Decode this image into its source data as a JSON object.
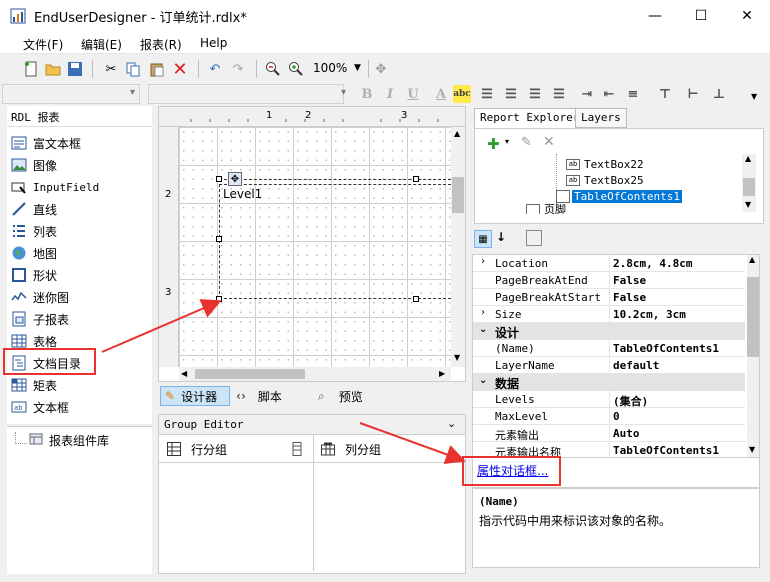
{
  "window": {
    "title": "EndUserDesigner - 订单统计.rdlx*",
    "minimize": "—",
    "maximize": "☐",
    "close": "✕"
  },
  "menu": [
    {
      "label": "文件(F)"
    },
    {
      "label": "编辑(E)"
    },
    {
      "label": "报表(R)"
    },
    {
      "label": "Help"
    }
  ],
  "toolbar": {
    "zoom": "100%"
  },
  "toolbox": {
    "header": "RDL 报表",
    "items": [
      {
        "label": "富文本框",
        "icon": "rich-text-icon"
      },
      {
        "label": "图像",
        "icon": "image-icon"
      },
      {
        "label": "InputField",
        "icon": "input-field-icon"
      },
      {
        "label": "直线",
        "icon": "line-icon"
      },
      {
        "label": "列表",
        "icon": "list-icon"
      },
      {
        "label": "地图",
        "icon": "map-icon"
      },
      {
        "label": "形状",
        "icon": "shape-icon"
      },
      {
        "label": "迷你图",
        "icon": "sparkline-icon"
      },
      {
        "label": "子报表",
        "icon": "subreport-icon"
      },
      {
        "label": "表格",
        "icon": "table-icon"
      },
      {
        "label": "文档目录",
        "icon": "toc-icon"
      },
      {
        "label": "矩表",
        "icon": "matrix-icon"
      },
      {
        "label": "文本框",
        "icon": "textbox-icon"
      }
    ],
    "component_library": "报表组件库"
  },
  "designer": {
    "ruler_marks": [
      "1",
      "2",
      "3"
    ],
    "ruler_v_marks": [
      "2",
      "3"
    ],
    "level_label": "Level1"
  },
  "design_tabs": {
    "designer": "设计器",
    "script": "脚本",
    "preview": "预览"
  },
  "group_editor": {
    "title": "Group Editor",
    "row_group": "行分组",
    "col_group": "列分组"
  },
  "right_panel": {
    "tabs": [
      "Report Explorer",
      "Layers"
    ],
    "tree": [
      {
        "label": "TextBox22"
      },
      {
        "label": "TextBox25"
      },
      {
        "label": "TableOfContents1"
      },
      {
        "label": "页脚"
      }
    ],
    "properties": [
      {
        "type": "prop",
        "name": "Location",
        "value": "2.8cm, 4.8cm",
        "expand": true
      },
      {
        "type": "prop",
        "name": "PageBreakAtEnd",
        "value": "False"
      },
      {
        "type": "prop",
        "name": "PageBreakAtStart",
        "value": "False"
      },
      {
        "type": "prop",
        "name": "Size",
        "value": "10.2cm, 3cm",
        "expand": true
      },
      {
        "type": "cat",
        "name": "设计"
      },
      {
        "type": "prop",
        "name": "(Name)",
        "value": "TableOfContents1"
      },
      {
        "type": "prop",
        "name": "LayerName",
        "value": "default"
      },
      {
        "type": "cat",
        "name": "数据"
      },
      {
        "type": "prop",
        "name": "Levels",
        "value": "(集合)"
      },
      {
        "type": "prop",
        "name": "MaxLevel",
        "value": "0"
      },
      {
        "type": "prop",
        "name": "元素输出",
        "value": "Auto"
      },
      {
        "type": "prop",
        "name": "元素输出名称",
        "value": "TableOfContents1"
      }
    ],
    "prop_dialog_link": "属性对话框...",
    "desc_title": "(Name)",
    "desc_text": "指示代码中用来标识该对象的名称。"
  },
  "colors": {
    "highlight": "#e8322e",
    "selection": "#0078d7",
    "link": "#0000ee"
  }
}
